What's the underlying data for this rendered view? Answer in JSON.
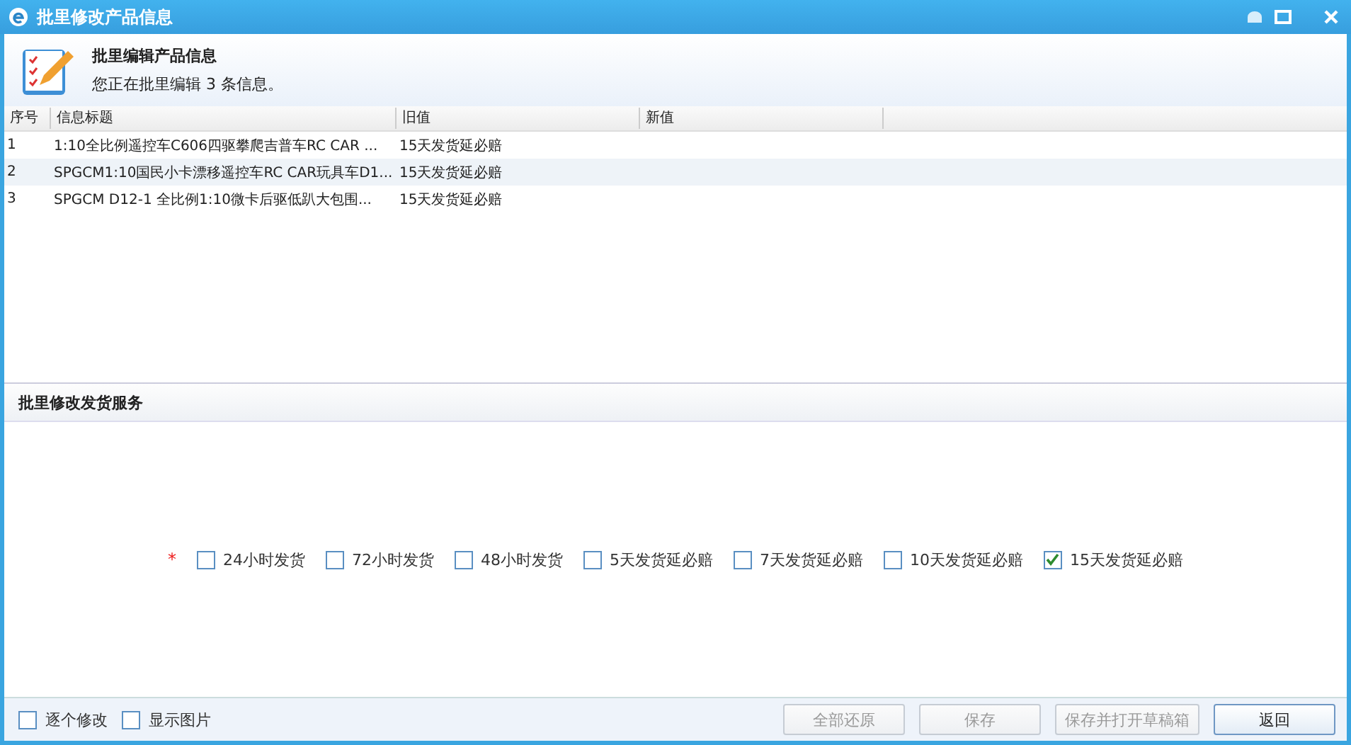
{
  "window": {
    "title": "批里修改产品信息"
  },
  "header": {
    "title": "批里编辑产品信息",
    "subtitle": "您正在批里编辑 3 条信息。"
  },
  "table": {
    "columns": [
      "序号",
      "信息标题",
      "旧值",
      "新值"
    ],
    "rows": [
      {
        "cells": [
          "1",
          "1:10全比例遥控车C606四驱攀爬吉普车RC CAR ...",
          "15天发货延必赔",
          ""
        ]
      },
      {
        "cells": [
          "2",
          "SPGCM1:10国民小卡漂移遥控车RC CAR玩具车D1...",
          "15天发货延必赔",
          ""
        ]
      },
      {
        "cells": [
          "3",
          "SPGCM D12-1 全比例1:10微卡后驱低趴大包围...",
          "15天发货延必赔",
          ""
        ]
      }
    ]
  },
  "section": {
    "title": "批里修改发货服务",
    "required_mark": "*",
    "options": [
      {
        "label": "24小时发货",
        "checked": false
      },
      {
        "label": "72小时发货",
        "checked": false
      },
      {
        "label": "48小时发货",
        "checked": false
      },
      {
        "label": "5天发货延必赔",
        "checked": false
      },
      {
        "label": "7天发货延必赔",
        "checked": false
      },
      {
        "label": "10天发货延必赔",
        "checked": false
      },
      {
        "label": "15天发货延必赔",
        "checked": true
      }
    ]
  },
  "footer": {
    "options": [
      {
        "label": "逐个修改",
        "checked": false
      },
      {
        "label": "显示图片",
        "checked": false
      }
    ],
    "buttons": [
      {
        "label": "全部还原",
        "disabled": true
      },
      {
        "label": "保存",
        "disabled": true
      },
      {
        "label": "保存并打开草稿箱",
        "disabled": true
      },
      {
        "label": "返回",
        "disabled": false
      }
    ]
  }
}
